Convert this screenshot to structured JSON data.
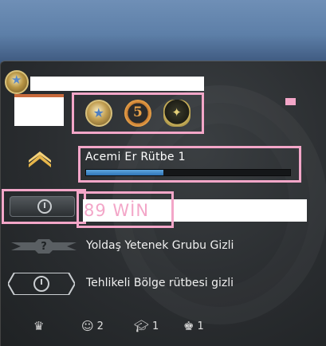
{
  "profile": {
    "rank_name": "Acemi Er Rütbe 1",
    "xp_progress": 0.38,
    "wins_text": "89 WİN",
    "wingman_text": "Yoldaş Yetenek Grubu Gizli",
    "danger_zone_text": "Tehlikeli Bölge rütbesi gizli"
  },
  "medals": [
    {
      "icon": "service-medal-icon"
    },
    {
      "icon": "five-year-coin-icon"
    },
    {
      "icon": "operation-coin-icon"
    }
  ],
  "footer": {
    "commends_friendly": "2",
    "commends_teacher": "1",
    "commends_leader": "1"
  },
  "colors": {
    "highlight": "#f3a6c8",
    "xp_bar": "#3a86c8"
  }
}
